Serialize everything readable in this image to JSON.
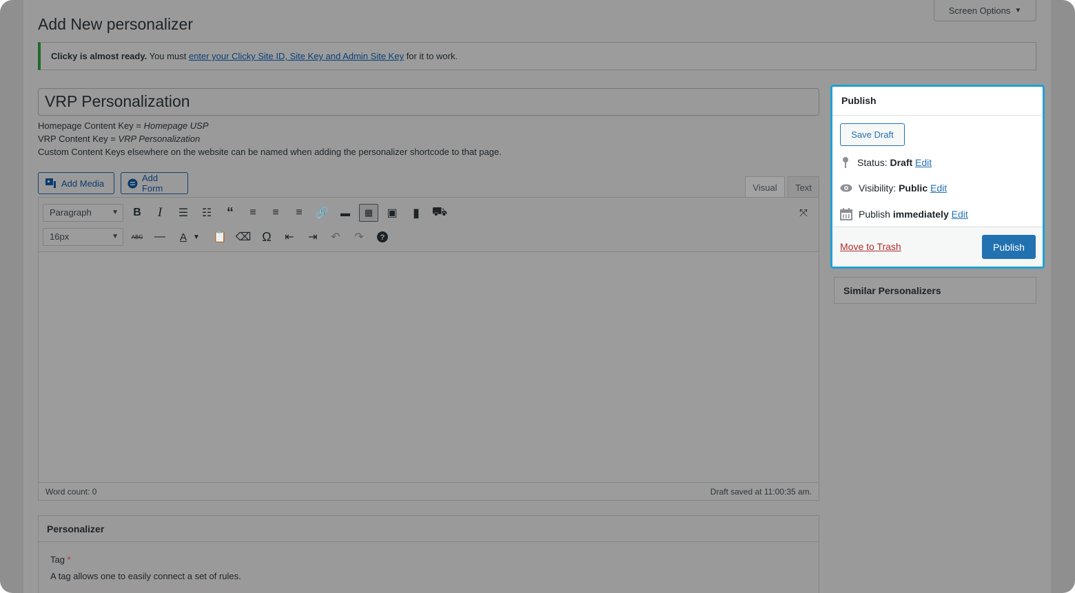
{
  "page": {
    "title": "Add New personalizer",
    "screen_options": "Screen Options"
  },
  "notice": {
    "strong": "Clicky is almost ready.",
    "text1": " You must ",
    "link": "enter your Clicky Site ID, Site Key and Admin Site Key",
    "text2": " for it to work."
  },
  "post": {
    "title": "VRP Personalization"
  },
  "description": {
    "line1_label": "Homepage Content Key = ",
    "line1_value": "Homepage USP",
    "line2_label": "VRP Content Key = ",
    "line2_value": "VRP Personalization",
    "line3": "Custom Content Keys elsewhere on the website can be named when adding the personalizer shortcode to that page."
  },
  "media": {
    "add_media": "Add Media",
    "add_form": "Add Form"
  },
  "tabs": {
    "visual": "Visual",
    "text": "Text"
  },
  "toolbar": {
    "format": "Paragraph",
    "font_size": "16px",
    "strike_label": "ABC"
  },
  "editor": {
    "word_count": "Word count: 0",
    "draft_saved": "Draft saved at 11:00:35 am."
  },
  "personalizer_box": {
    "title": "Personalizer",
    "tag_label": "Tag",
    "required_mark": "*",
    "tag_help": "A tag allows one to easily connect a set of rules."
  },
  "publish": {
    "title": "Publish",
    "save_draft": "Save Draft",
    "status_label": "Status: ",
    "status_value": "Draft",
    "visibility_label": "Visibility: ",
    "visibility_value": "Public",
    "publish_label": "Publish ",
    "publish_value": "immediately",
    "edit": "Edit",
    "trash": "Move to Trash",
    "publish_button": "Publish"
  },
  "similar": {
    "title": "Similar Personalizers"
  }
}
